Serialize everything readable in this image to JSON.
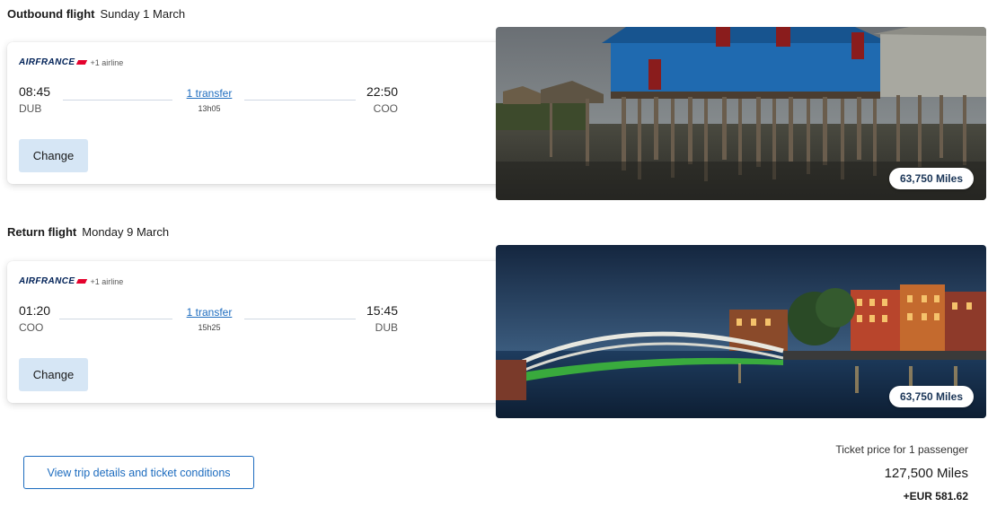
{
  "outbound": {
    "title": "Outbound flight",
    "date": "Sunday 1 March",
    "airline_logo": "AIRFRANCE",
    "airline_extra": "+1 airline",
    "dep_time": "08:45",
    "dep_code": "DUB",
    "arr_time": "22:50",
    "arr_code": "COO",
    "transfer": "1 transfer",
    "duration": "13h05",
    "change_label": "Change",
    "miles": "63,750 Miles"
  },
  "return": {
    "title": "Return flight",
    "date": "Monday 9 March",
    "airline_logo": "AIRFRANCE",
    "airline_extra": "+1 airline",
    "dep_time": "01:20",
    "dep_code": "COO",
    "arr_time": "15:45",
    "arr_code": "DUB",
    "transfer": "1 transfer",
    "duration": "15h25",
    "change_label": "Change",
    "miles": "63,750 Miles"
  },
  "footer": {
    "details_button": "View trip details and ticket conditions",
    "price_label": "Ticket price for 1 passenger",
    "total_miles": "127,500 Miles",
    "surcharge": "+EUR 581.62"
  },
  "colors": {
    "link": "#1d6cbf",
    "button_bg": "#d6e6f5",
    "brand_navy": "#002157",
    "brand_red": "#e4022d"
  }
}
